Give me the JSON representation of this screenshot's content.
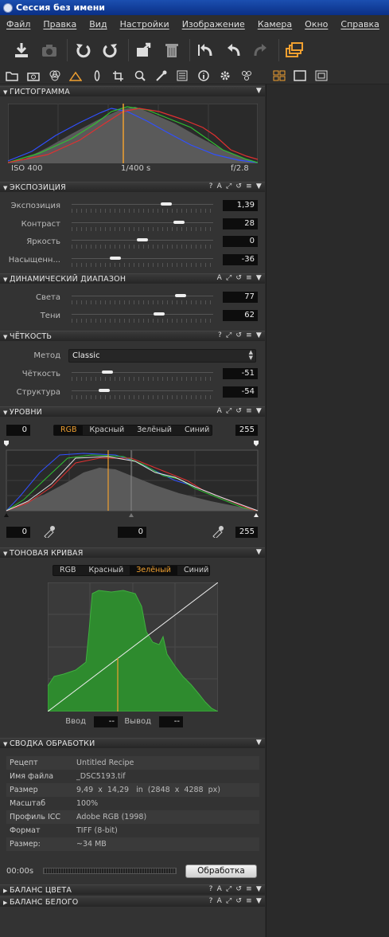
{
  "window": {
    "title": "Сессия без имени"
  },
  "menu": [
    "Файл",
    "Правка",
    "Вид",
    "Настройки",
    "Изображение",
    "Камера",
    "Окно",
    "Справка"
  ],
  "toolbar_icons": [
    "import-icon",
    "camera-icon",
    "rotate-left-icon",
    "rotate-right-icon",
    "export-icon",
    "trash-icon",
    "undo-icon",
    "undo-step-icon",
    "redo-icon",
    "workspace-icon"
  ],
  "tool_tabs": [
    "folder-icon",
    "capture-icon",
    "color-icon",
    "exposure-icon",
    "lens-icon",
    "crop-icon",
    "details-icon",
    "adjustments-icon",
    "metadata-icon",
    "info-icon",
    "settings-icon",
    "batch-icon"
  ],
  "histogram": {
    "title": "ГИСТОГРАММА",
    "iso": "ISO 400",
    "shutter": "1/400 s",
    "aperture": "f/2.8"
  },
  "exposure": {
    "title": "ЭКСПОЗИЦИЯ",
    "sliders": [
      {
        "label": "Экспозиция",
        "value": "1,39",
        "pos": 0.67
      },
      {
        "label": "Контраст",
        "value": "28",
        "pos": 0.76
      },
      {
        "label": "Яркость",
        "value": "0",
        "pos": 0.5
      },
      {
        "label": "Насыщенн...",
        "value": "-36",
        "pos": 0.31
      }
    ]
  },
  "dynamic_range": {
    "title": "ДИНАМИЧЕСКИЙ ДИАПАЗОН",
    "sliders": [
      {
        "label": "Света",
        "value": "77",
        "pos": 0.77
      },
      {
        "label": "Тени",
        "value": "62",
        "pos": 0.62
      }
    ]
  },
  "clarity": {
    "title": "ЧЁТКОСТЬ",
    "method_label": "Метод",
    "method_value": "Classic",
    "sliders": [
      {
        "label": "Чёткость",
        "value": "-51",
        "pos": 0.25
      },
      {
        "label": "Структура",
        "value": "-54",
        "pos": 0.23
      }
    ]
  },
  "levels": {
    "title": "УРОВНИ",
    "input_low": "0",
    "input_high": "255",
    "channels": [
      "RGB",
      "Красный",
      "Зелёный",
      "Синий"
    ],
    "active_channel": "RGB",
    "output_low": "0",
    "output_mid": "0",
    "output_high": "255"
  },
  "tone_curve": {
    "title": "ТОНОВАЯ КРИВАЯ",
    "channels": [
      "RGB",
      "Красный",
      "Зелёный",
      "Синий"
    ],
    "active_channel": "Зелёный",
    "input_label": "Ввод",
    "input_value": "--",
    "output_label": "Вывод",
    "output_value": "--"
  },
  "summary": {
    "title": "СВОДКА ОБРАБОТКИ",
    "rows": [
      {
        "k": "Рецепт",
        "v": "Untitled Recipe"
      },
      {
        "k": "Имя файла",
        "v": "_DSC5193.tif"
      },
      {
        "k": "Размер",
        "v": "9,49  x  14,29   in  (2848  x  4288  px)"
      },
      {
        "k": "Масштаб",
        "v": "100%"
      },
      {
        "k": "Профиль ICC",
        "v": "Adobe RGB (1998)"
      },
      {
        "k": "Формат",
        "v": "TIFF (8-bit)"
      },
      {
        "k": "Размер:",
        "v": "~34 MB"
      }
    ],
    "time": "00:00s",
    "process_button": "Обработка"
  },
  "collapsed": [
    {
      "title": "БАЛАНС ЦВЕТА"
    },
    {
      "title": "БАЛАНС БЕЛОГО"
    }
  ],
  "colors": {
    "accent": "#f0a030",
    "histogram_green": "#2e8b2e"
  }
}
